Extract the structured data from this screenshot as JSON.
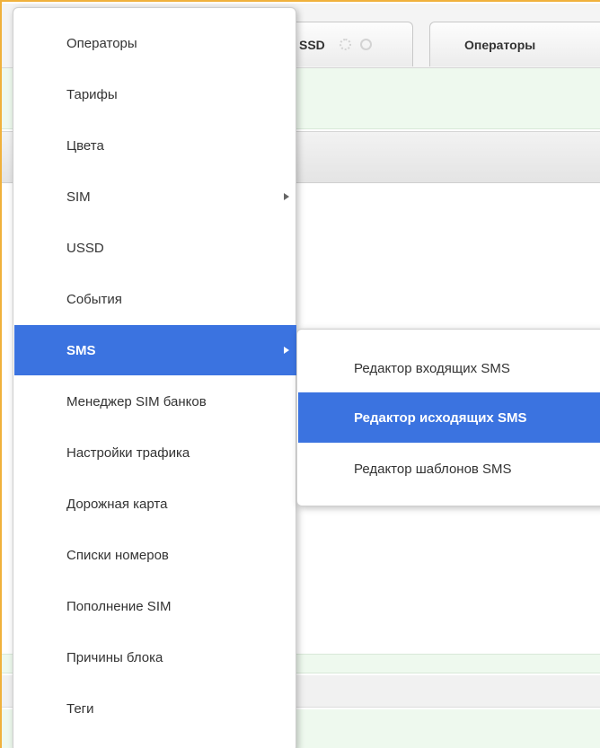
{
  "tabs": [
    {
      "label": "SSD"
    },
    {
      "label": "Операторы"
    }
  ],
  "menu": {
    "items": [
      {
        "label": "Операторы",
        "has_submenu": false
      },
      {
        "label": "Тарифы",
        "has_submenu": false
      },
      {
        "label": "Цвета",
        "has_submenu": false
      },
      {
        "label": "SIM",
        "has_submenu": true
      },
      {
        "label": "USSD",
        "has_submenu": false
      },
      {
        "label": "События",
        "has_submenu": false
      },
      {
        "label": "SMS",
        "has_submenu": true,
        "active": true
      },
      {
        "label": "Менеджер SIM банков",
        "has_submenu": false
      },
      {
        "label": "Настройки трафика",
        "has_submenu": false
      },
      {
        "label": "Дорожная карта",
        "has_submenu": false
      },
      {
        "label": "Списки номеров",
        "has_submenu": false
      },
      {
        "label": "Пополнение SIM",
        "has_submenu": false
      },
      {
        "label": "Причины блока",
        "has_submenu": false
      },
      {
        "label": "Теги",
        "has_submenu": false
      }
    ]
  },
  "submenu": {
    "items": [
      {
        "label": "Редактор входящих SMS"
      },
      {
        "label": "Редактор исходящих SMS",
        "active": true
      },
      {
        "label": "Редактор шаблонов SMS"
      }
    ]
  },
  "colors": {
    "accent": "#3b73e0",
    "window_border": "#f0b13c",
    "panel_green": "#eef9ee"
  }
}
